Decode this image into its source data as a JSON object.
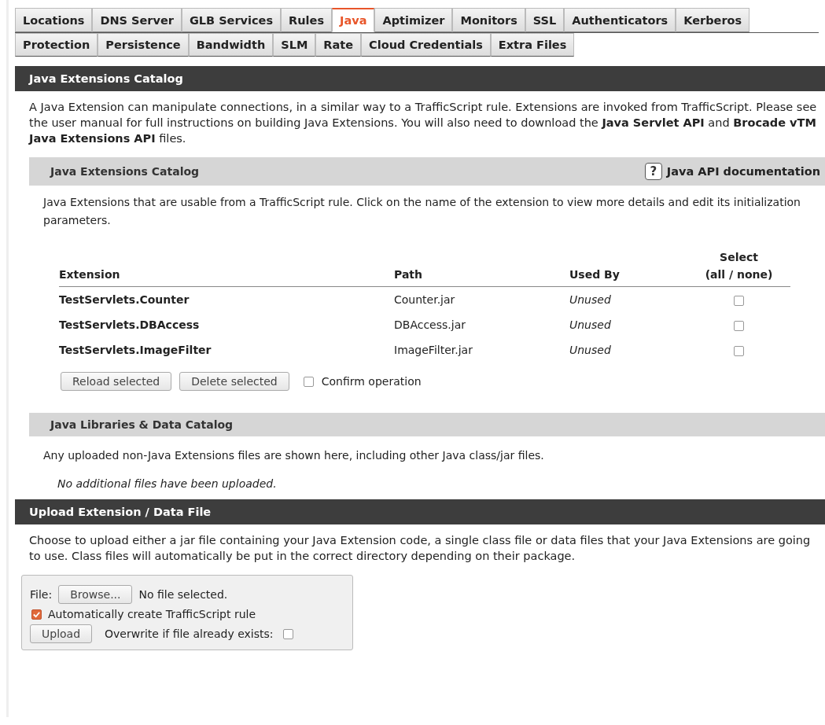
{
  "tabs": [
    [
      {
        "label": "Locations",
        "selected": false
      },
      {
        "label": "DNS Server",
        "selected": false
      },
      {
        "label": "GLB Services",
        "selected": false
      },
      {
        "label": "Rules",
        "selected": false
      },
      {
        "label": "Java",
        "selected": true
      },
      {
        "label": "Aptimizer",
        "selected": false
      },
      {
        "label": "Monitors",
        "selected": false
      },
      {
        "label": "SSL",
        "selected": false
      },
      {
        "label": "Authenticators",
        "selected": false
      },
      {
        "label": "Kerberos",
        "selected": false
      }
    ],
    [
      {
        "label": "Protection",
        "selected": false
      },
      {
        "label": "Persistence",
        "selected": false
      },
      {
        "label": "Bandwidth",
        "selected": false
      },
      {
        "label": "SLM",
        "selected": false
      },
      {
        "label": "Rate",
        "selected": false
      },
      {
        "label": "Cloud Credentials",
        "selected": false
      },
      {
        "label": "Extra Files",
        "selected": false
      }
    ]
  ],
  "catalog_section": {
    "title": "Java Extensions Catalog",
    "intro": "A Java Extension can manipulate connections, in a similar way to a TrafficScript rule. Extensions are invoked from TrafficScript. Please see the user manual for full instructions on building Java Extensions. You will also need to download the **Java Servlet API** and **Brocade vTM Java Extensions API** files."
  },
  "extensions_panel": {
    "title": "Java Extensions Catalog",
    "help_icon": "?",
    "help_link": "Java API documentation",
    "description": "Java Extensions that are usable from a TrafficScript rule. Click on the name of the extension to view more details and edit its initialization parameters.",
    "columns": [
      "Extension",
      "Path",
      "Used By"
    ],
    "select_header": "Select",
    "select_links": "(all / none)",
    "rows": [
      {
        "extension": "TestServlets.Counter",
        "path": "Counter.jar",
        "used_by": "Unused",
        "checked": false
      },
      {
        "extension": "TestServlets.DBAccess",
        "path": "DBAccess.jar",
        "used_by": "Unused",
        "checked": false
      },
      {
        "extension": "TestServlets.ImageFilter",
        "path": "ImageFilter.jar",
        "used_by": "Unused",
        "checked": false
      }
    ],
    "buttons": [
      "Reload selected",
      "Delete selected"
    ],
    "confirm": {
      "label": "Confirm operation",
      "checked": false
    }
  },
  "libraries_panel": {
    "title": "Java Libraries & Data Catalog",
    "description": "Any uploaded non-Java Extensions files are shown here, including other Java class/jar files.",
    "empty_note": "No additional files have been uploaded."
  },
  "upload_section": {
    "title": "Upload Extension / Data File",
    "intro": "Choose to upload either a jar file containing your Java Extension code, a single class file or data files that your Java Extensions are going to use. Class files will automatically be put in the correct directory depending on their package.",
    "file_label": "File:",
    "browse_button": "Browse...",
    "file_status": "No file selected.",
    "auto_rule": {
      "label": "Automatically create TrafficScript rule",
      "checked": true
    },
    "upload_button": "Upload",
    "overwrite": {
      "label": "Overwrite if file already exists:",
      "checked": false
    }
  }
}
